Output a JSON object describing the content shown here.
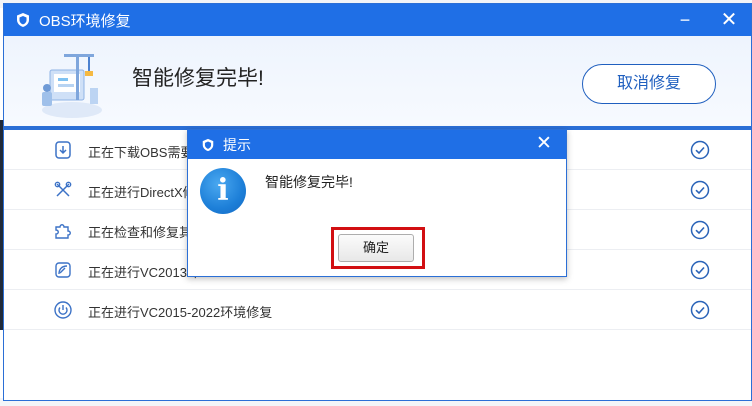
{
  "window": {
    "title": "OBS环境修复",
    "minimize_glyph": "−",
    "close_glyph": "✕"
  },
  "header": {
    "headline": "智能修复完毕!",
    "cancel_label": "取消修复"
  },
  "tasks": [
    {
      "icon": "download-icon",
      "label": "正在下载OBS需要的"
    },
    {
      "icon": "tools-icon",
      "label": "正在进行DirectX修"
    },
    {
      "icon": "puzzle-icon",
      "label": "正在检查和修复其他"
    },
    {
      "icon": "gauge-icon",
      "label": "正在进行VC2013环"
    },
    {
      "icon": "power-icon",
      "label": "正在进行VC2015-2022环境修复"
    }
  ],
  "dialog": {
    "title": "提示",
    "close_glyph": "✕",
    "info_glyph": "i",
    "message": "智能修复完毕!",
    "ok_label": "确定"
  },
  "colors": {
    "accent": "#1f6fe6",
    "cancel_border": "#1f5fbf",
    "check_color": "#2a63b8",
    "highlight_frame": "#d20f12"
  }
}
